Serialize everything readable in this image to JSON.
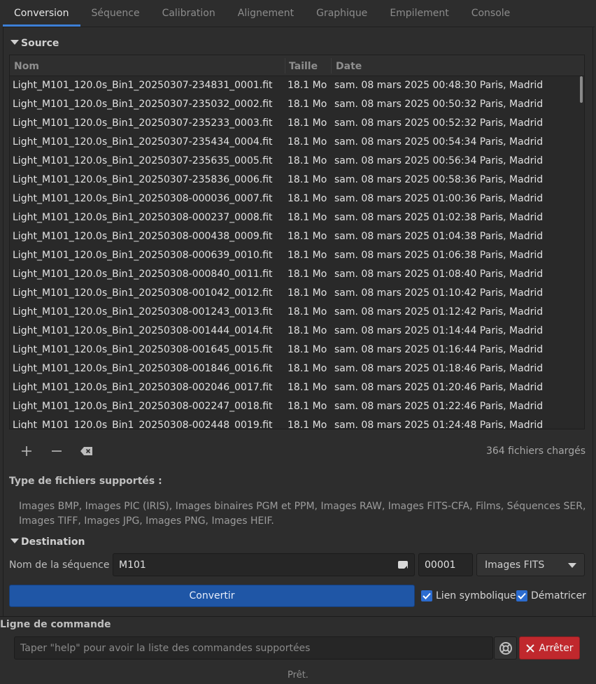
{
  "tabs": [
    "Conversion",
    "Séquence",
    "Calibration",
    "Alignement",
    "Graphique",
    "Empilement",
    "Console"
  ],
  "active_tab": 0,
  "source": {
    "title": "Source",
    "columns": [
      "Nom",
      "Taille",
      "Date"
    ],
    "rows": [
      [
        "Light_M101_120.0s_Bin1_20250307-234831_0001.fit",
        "18.1 Mo",
        "sam. 08 mars 2025 00:48:30 Paris, Madrid"
      ],
      [
        "Light_M101_120.0s_Bin1_20250307-235032_0002.fit",
        "18.1 Mo",
        "sam. 08 mars 2025 00:50:32 Paris, Madrid"
      ],
      [
        "Light_M101_120.0s_Bin1_20250307-235233_0003.fit",
        "18.1 Mo",
        "sam. 08 mars 2025 00:52:32 Paris, Madrid"
      ],
      [
        "Light_M101_120.0s_Bin1_20250307-235434_0004.fit",
        "18.1 Mo",
        "sam. 08 mars 2025 00:54:34 Paris, Madrid"
      ],
      [
        "Light_M101_120.0s_Bin1_20250307-235635_0005.fit",
        "18.1 Mo",
        "sam. 08 mars 2025 00:56:34 Paris, Madrid"
      ],
      [
        "Light_M101_120.0s_Bin1_20250307-235836_0006.fit",
        "18.1 Mo",
        "sam. 08 mars 2025 00:58:36 Paris, Madrid"
      ],
      [
        "Light_M101_120.0s_Bin1_20250308-000036_0007.fit",
        "18.1 Mo",
        "sam. 08 mars 2025 01:00:36 Paris, Madrid"
      ],
      [
        "Light_M101_120.0s_Bin1_20250308-000237_0008.fit",
        "18.1 Mo",
        "sam. 08 mars 2025 01:02:38 Paris, Madrid"
      ],
      [
        "Light_M101_120.0s_Bin1_20250308-000438_0009.fit",
        "18.1 Mo",
        "sam. 08 mars 2025 01:04:38 Paris, Madrid"
      ],
      [
        "Light_M101_120.0s_Bin1_20250308-000639_0010.fit",
        "18.1 Mo",
        "sam. 08 mars 2025 01:06:38 Paris, Madrid"
      ],
      [
        "Light_M101_120.0s_Bin1_20250308-000840_0011.fit",
        "18.1 Mo",
        "sam. 08 mars 2025 01:08:40 Paris, Madrid"
      ],
      [
        "Light_M101_120.0s_Bin1_20250308-001042_0012.fit",
        "18.1 Mo",
        "sam. 08 mars 2025 01:10:42 Paris, Madrid"
      ],
      [
        "Light_M101_120.0s_Bin1_20250308-001243_0013.fit",
        "18.1 Mo",
        "sam. 08 mars 2025 01:12:42 Paris, Madrid"
      ],
      [
        "Light_M101_120.0s_Bin1_20250308-001444_0014.fit",
        "18.1 Mo",
        "sam. 08 mars 2025 01:14:44 Paris, Madrid"
      ],
      [
        "Light_M101_120.0s_Bin1_20250308-001645_0015.fit",
        "18.1 Mo",
        "sam. 08 mars 2025 01:16:44 Paris, Madrid"
      ],
      [
        "Light_M101_120.0s_Bin1_20250308-001846_0016.fit",
        "18.1 Mo",
        "sam. 08 mars 2025 01:18:46 Paris, Madrid"
      ],
      [
        "Light_M101_120.0s_Bin1_20250308-002046_0017.fit",
        "18.1 Mo",
        "sam. 08 mars 2025 01:20:46 Paris, Madrid"
      ],
      [
        "Light_M101_120.0s_Bin1_20250308-002247_0018.fit",
        "18.1 Mo",
        "sam. 08 mars 2025 01:22:46 Paris, Madrid"
      ],
      [
        "Light_M101_120.0s_Bin1_20250308-002448_0019.fit",
        "18.1 Mo",
        "sam. 08 mars 2025 01:24:48 Paris, Madrid"
      ]
    ],
    "loaded_count": "364 fichiers chargés"
  },
  "supported": {
    "title": "Type de fichiers supportés :",
    "text": "Images BMP, Images PIC (IRIS), Images binaires PGM et PPM, Images RAW, Images FITS-CFA, Films, Séquences SER, Images TIFF, Images JPG, Images PNG, Images HEIF."
  },
  "destination": {
    "title": "Destination",
    "seq_label": "Nom de la séquence :",
    "seq_value": "M101",
    "index_value": "00001",
    "format_selected": "Images FITS",
    "convert_label": "Convertir",
    "symlink_label": "Lien symbolique",
    "symlink_checked": true,
    "debayer_label": "Dématricer",
    "debayer_checked": true
  },
  "command": {
    "title": "Ligne de commande",
    "placeholder": "Taper \"help\" pour avoir la liste des commandes supportées",
    "stop_label": "Arrêter"
  },
  "status": "Prêt.",
  "colors": {
    "accent": "#3d7fd6",
    "convert_button": "#1f56a6",
    "stop_button": "#c0282d",
    "checkbox": "#2c6ccf"
  }
}
